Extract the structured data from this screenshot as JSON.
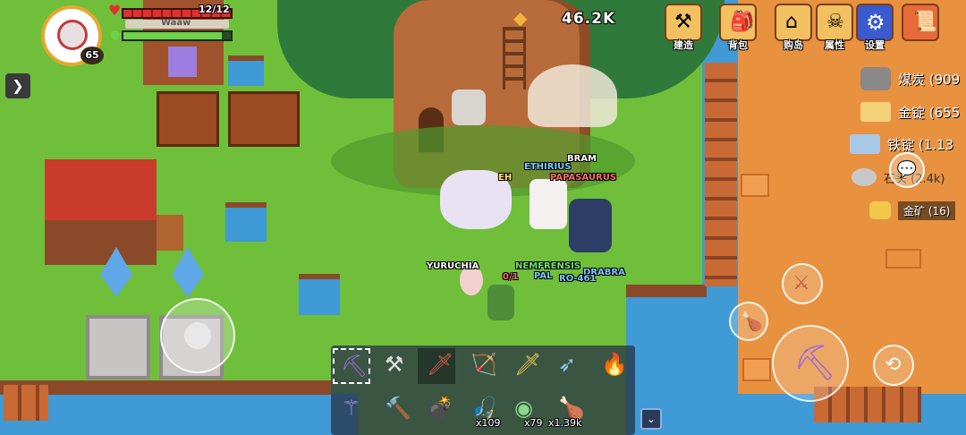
{
  "player": {
    "hp_text": "12/12",
    "name": "Waaw",
    "level": "65"
  },
  "currency": {
    "amount": "46.2K"
  },
  "menu": [
    {
      "label": "建造",
      "icon": "anvil-icon"
    },
    {
      "label": "背包",
      "icon": "backpack-icon"
    },
    {
      "label": "购岛",
      "icon": "shop-icon"
    },
    {
      "label": "属性",
      "icon": "skull-icon"
    },
    {
      "label": "设置",
      "icon": "gear-icon"
    },
    {
      "label": "",
      "icon": "map-scroll-icon"
    }
  ],
  "resources": [
    {
      "name": "煤炭 (909",
      "icon": "coal-icon"
    },
    {
      "name": "金锭 (655",
      "icon": "gold-ingot-icon"
    },
    {
      "name": "铁锭 (1.13",
      "icon": "iron-ingot-icon"
    },
    {
      "name": "石头 (2.4k)",
      "icon": "stone-icon"
    },
    {
      "name": "金矿 (16)",
      "icon": "gold-ore-icon"
    }
  ],
  "npc_tags": [
    "BRAM",
    "ETHIRIUS",
    "PAPASAURUS",
    "EH",
    "YURUCHIA",
    "NEMFRENSIS",
    "PAL",
    "DRABRA",
    "RO-461",
    "0/1"
  ],
  "hotbar": {
    "row1": [
      "pickaxe-crossbow-icon",
      "shovel-icon",
      "sword-icon",
      "bow-icon",
      "golden-sword-icon",
      "spear-icon",
      "torch-icon"
    ],
    "row2": [
      "scepter-icon",
      "hammer-icon",
      "bomb-icon",
      "fishing-rod-icon",
      "orb-icon",
      "drumstick-icon"
    ],
    "counts": [
      "x109",
      "x79",
      "x1.39k"
    ]
  },
  "colors": {
    "hp": "#e03030",
    "energy": "#6fd24a",
    "accent": "#f2c060"
  }
}
